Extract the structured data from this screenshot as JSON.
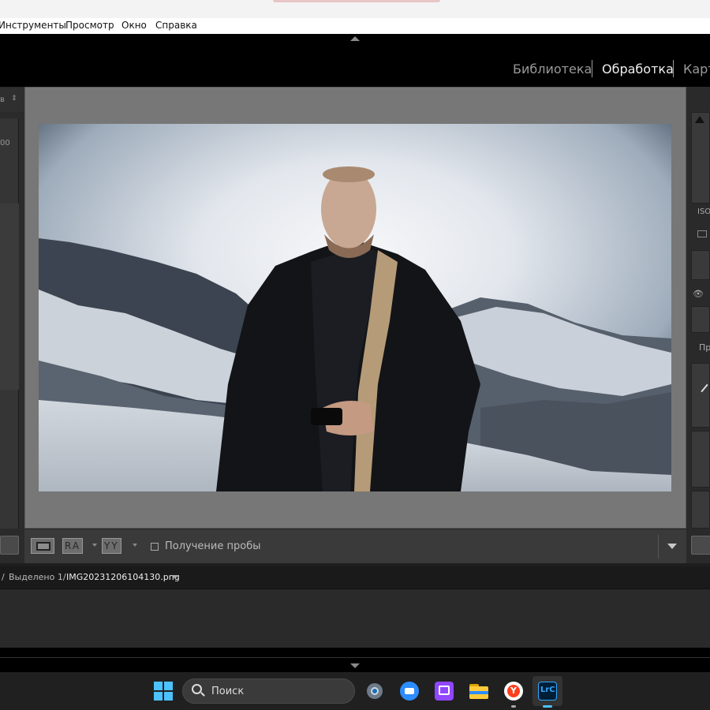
{
  "menu": [
    "Инструменты",
    "Просмотр",
    "Окно",
    "Справка"
  ],
  "modules": [
    {
      "label": "Библиотека",
      "active": false
    },
    {
      "label": "Обработка",
      "active": true
    },
    {
      "label": "Карт",
      "active": false
    }
  ],
  "left_panel": {
    "tiny_text_1": "в",
    "tiny_text_2": "00"
  },
  "right_panel": {
    "iso_label": "ISO",
    "pr_label": "Пр"
  },
  "toolbar": {
    "ra_label": "RA",
    "yy_label": "YY",
    "sample_label": "Получение пробы"
  },
  "filmstrip": {
    "prefix": "/",
    "selected_text": "Выделено 1/",
    "filename": "IMG20231206104130.png"
  },
  "taskbar": {
    "search_placeholder": "Поиск",
    "apps": [
      "windows-start",
      "search",
      "settings",
      "zoom",
      "twitch",
      "file-explorer",
      "yandex-browser",
      "lightroom-classic"
    ],
    "lrc_label": "LrC"
  },
  "colors": {
    "accent_lr": "#31a8ff",
    "twitch": "#9146ff",
    "yandex": "#fc3f1d"
  }
}
